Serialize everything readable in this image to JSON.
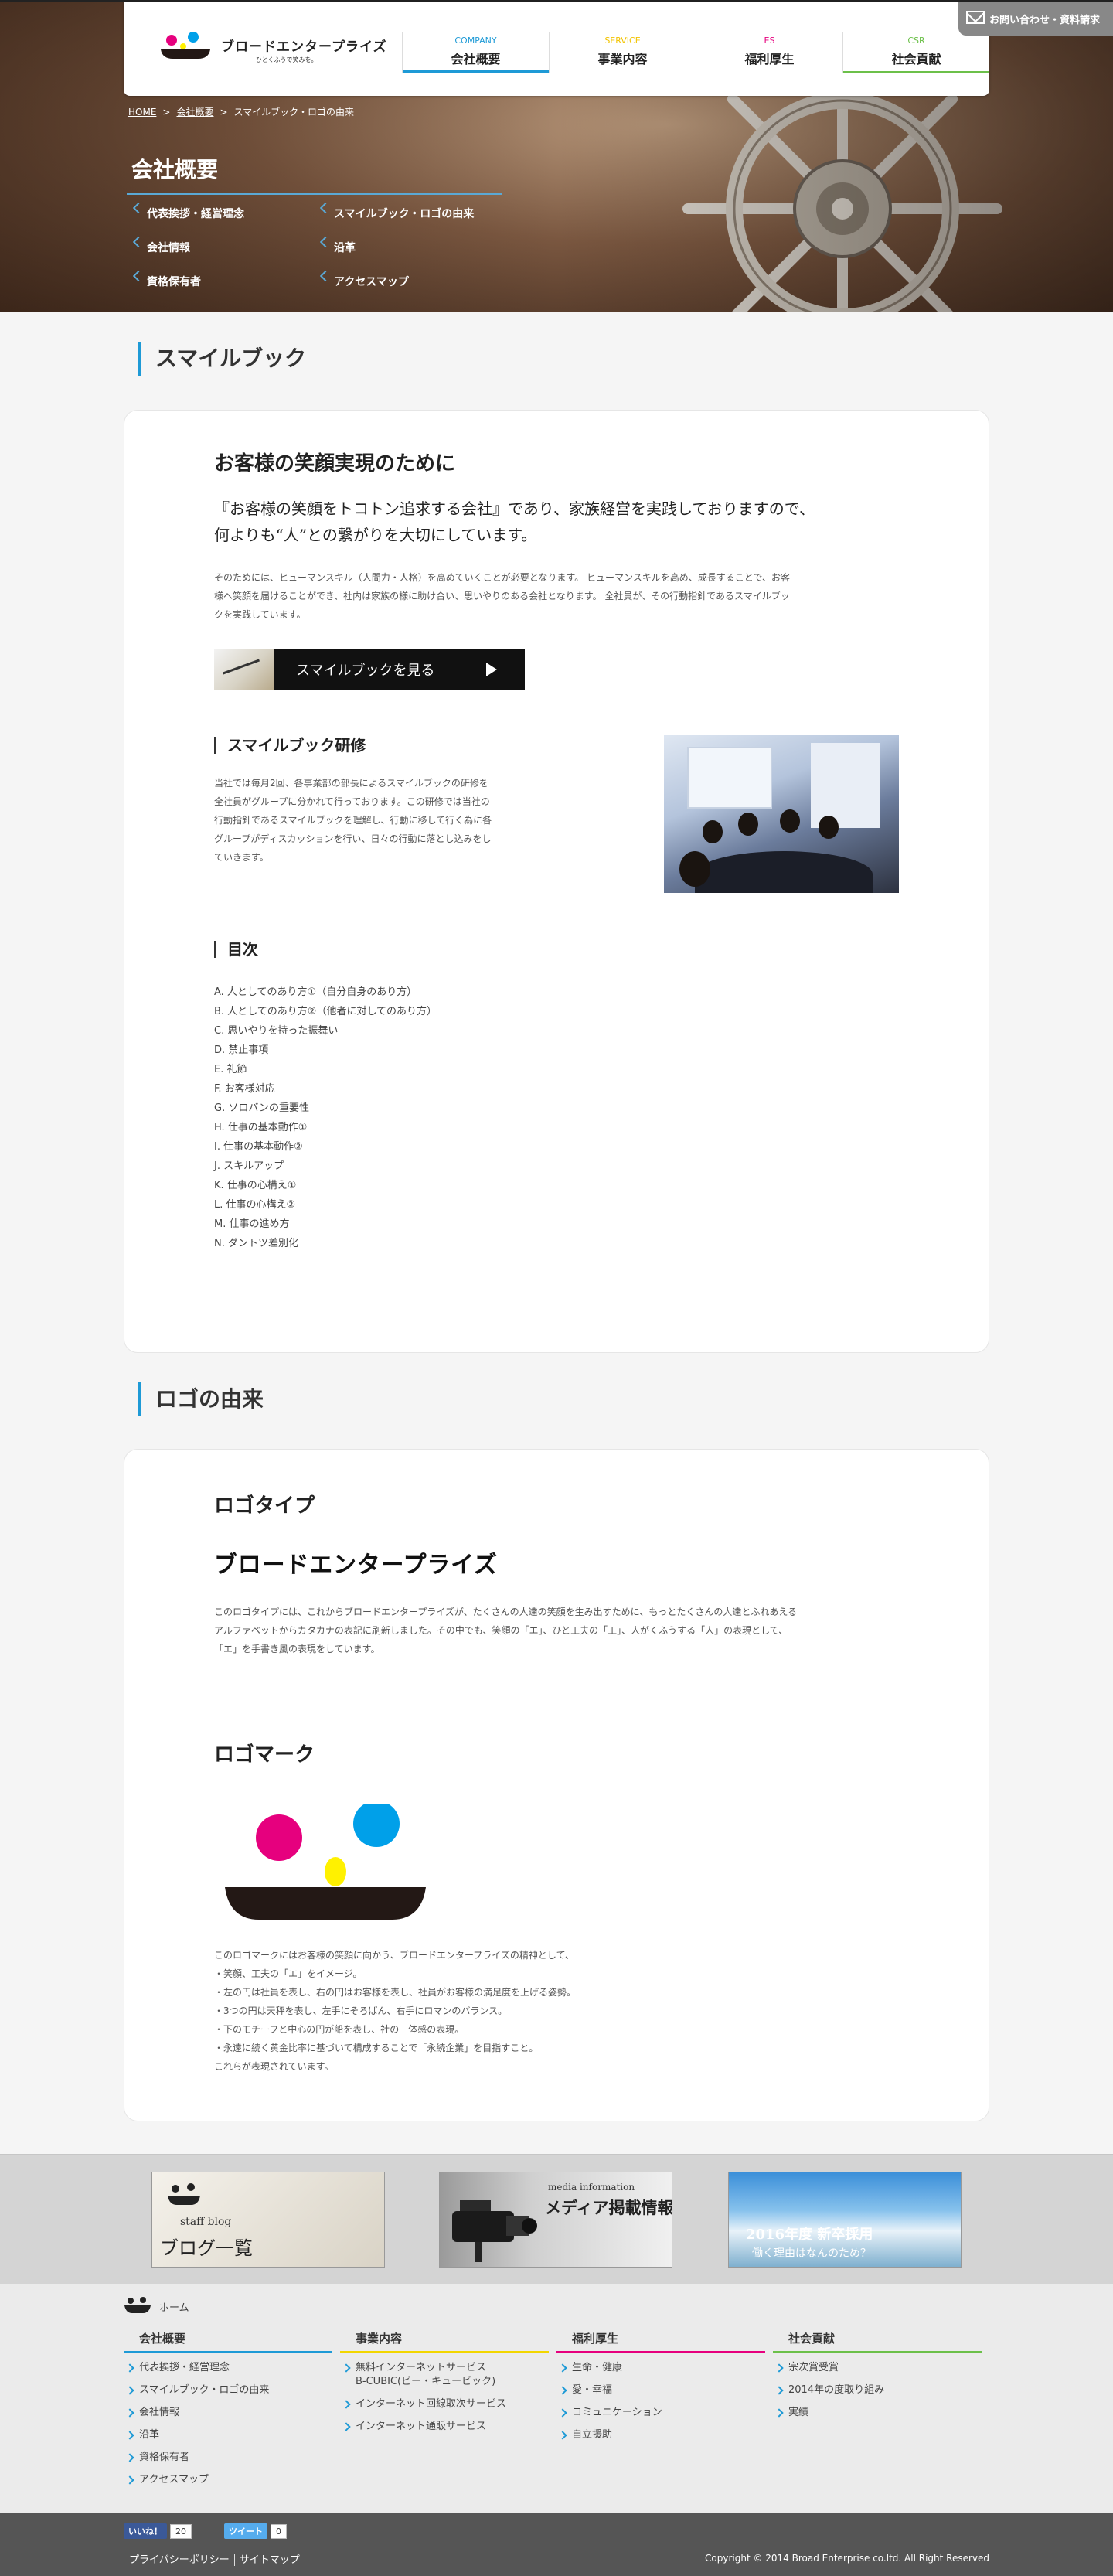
{
  "header": {
    "logo_text": "ブロードエンタープライズ",
    "logo_sub": "ひとくふうで笑みを。",
    "contact_label": "お問い合わせ・資料請求",
    "nav": [
      {
        "en": "COMPANY",
        "jp": "会社概要",
        "color": "#1e9ad6"
      },
      {
        "en": "SERVICE",
        "jp": "事業内容",
        "color": "#f2d600"
      },
      {
        "en": "ES",
        "jp": "福利厚生",
        "color": "#e6007e"
      },
      {
        "en": "CSR",
        "jp": "社会貢献",
        "color": "#6cc04a"
      }
    ]
  },
  "breadcrumb": {
    "home": "HOME",
    "sep": ">",
    "parent": "会社概要",
    "current": "スマイルブック・ロゴの由来"
  },
  "hero": {
    "title": "会社概要",
    "subnav": [
      "代表挨拶・経営理念",
      "スマイルブック・ロゴの由来",
      "会社情報",
      "沿革",
      "資格保有者",
      "アクセスマップ"
    ]
  },
  "smilebook": {
    "section_title": "スマイルブック",
    "heading": "お客様の笑顔実現のために",
    "lead_1": "『お客様の笑顔をトコトン追求する会社』であり、家族経営を実践しておりますので、",
    "lead_2": "何よりも“人”との繋がりを大切にしています。",
    "body_1": "そのためには、ヒューマンスキル（人間力・人格）を高めていくことが必要となります。 ヒューマンスキルを高め、成長することで、お客",
    "body_2": "様へ笑顔を届けることができ、社内は家族の様に助け合い、思いやりのある会社となります。 全社員が、その行動指針であるスマイルブッ",
    "body_3": "クを実践しています。",
    "button_label": "スマイルブックを見る",
    "training_title": "スマイルブック研修",
    "training_1": "当社では毎月2回、各事業部の部長によるスマイルブックの研修を",
    "training_2": "全社員がグループに分かれて行っております。この研修では当社の",
    "training_3": "行動指針であるスマイルブックを理解し、行動に移して行く為に各",
    "training_4": "グループがディスカッションを行い、日々の行動に落とし込みをし",
    "training_5": "ていきます。",
    "toc_title": "目次",
    "toc": [
      "A. 人としてのあり方①（自分自身のあり方）",
      "B. 人としてのあり方②（他者に対してのあり方）",
      "C. 思いやりを持った振舞い",
      "D. 禁止事項",
      "E. 礼節",
      "F. お客様対応",
      "G. ソロバンの重要性",
      "H. 仕事の基本動作①",
      "I. 仕事の基本動作②",
      "J. スキルアップ",
      "K. 仕事の心構え①",
      "L. 仕事の心構え②",
      "M. 仕事の進め方",
      "N. ダントツ差別化"
    ]
  },
  "logo_origin": {
    "section_title": "ロゴの由来",
    "logotype_title": "ロゴタイプ",
    "logotype_text": "ブロードエンタープライズ",
    "logotype_1": "このロゴタイプには、これからブロードエンタープライズが、たくさんの人達の笑顔を生み出すために、もっとたくさんの人達とふれあえる",
    "logotype_2": "アルファベットからカタカナの表記に刷新しました。その中でも、笑顔の「エ」、ひと工夫の「工」、人がくふうする「人」の表現として、",
    "logotype_3": "「エ」を手書き風の表現をしています。",
    "logomark_title": "ロゴマーク",
    "mark_1": "このロゴマークにはお客様の笑顔に向かう、ブロードエンタープライズの精神として、",
    "mark_2": "・笑顔、工夫の「エ」をイメージ。",
    "mark_3": "・左の円は社員を表し、右の円はお客様を表し、社員がお客様の満足度を上げる姿勢。",
    "mark_4": "・3つの円は天秤を表し、左手にそろばん、右手にロマンのバランス。",
    "mark_5": "・下のモチーフと中心の円が船を表し、社の一体感の表現。",
    "mark_6": "・永遠に続く黄金比率に基づいて構成することで「永続企業」を目指すこと。",
    "mark_7": "これらが表現されています。",
    "colors": {
      "magenta": "#e6007e",
      "cyan": "#00a0e9",
      "yellow": "#fff100",
      "black": "#231815"
    }
  },
  "banners": [
    {
      "t1": "staff blog",
      "t2": "ブログ一覧"
    },
    {
      "t1": "media information",
      "t2": "メディア掲載情報"
    },
    {
      "t1": "2016年度 新卒採用",
      "t2": "働く理由はなんのため？"
    }
  ],
  "footer": {
    "home": "ホーム",
    "cols": [
      {
        "title": "会社概要",
        "links": [
          "代表挨拶・経営理念",
          "スマイルブック・ロゴの由来",
          "会社情報",
          "沿革",
          "資格保有者",
          "アクセスマップ"
        ],
        "color": "#1e9ad6"
      },
      {
        "title": "事業内容",
        "links": [
          "無料インターネットサービス",
          "インターネット回線取次サービス",
          "インターネット通販サービス"
        ],
        "sub": "B-CUBIC(ビー・キュービック)",
        "color": "#f2d600"
      },
      {
        "title": "福利厚生",
        "links": [
          "生命・健康",
          "愛・幸福",
          "コミュニケーション",
          "自立援助"
        ],
        "color": "#e6007e"
      },
      {
        "title": "社会貢献",
        "links": [
          "宗次賞受賞",
          "2014年の度取り組み",
          "実績"
        ],
        "color": "#6cc04a"
      }
    ],
    "like_label": "いいね！",
    "like_count": "20",
    "tweet_label": "ツイート",
    "tweet_count": "0",
    "privacy": "プライバシーポリシー",
    "sitemap": "サイトマップ",
    "copyright": "Copyright © 2014 Broad Enterprise co.ltd. All Right Reserved"
  }
}
